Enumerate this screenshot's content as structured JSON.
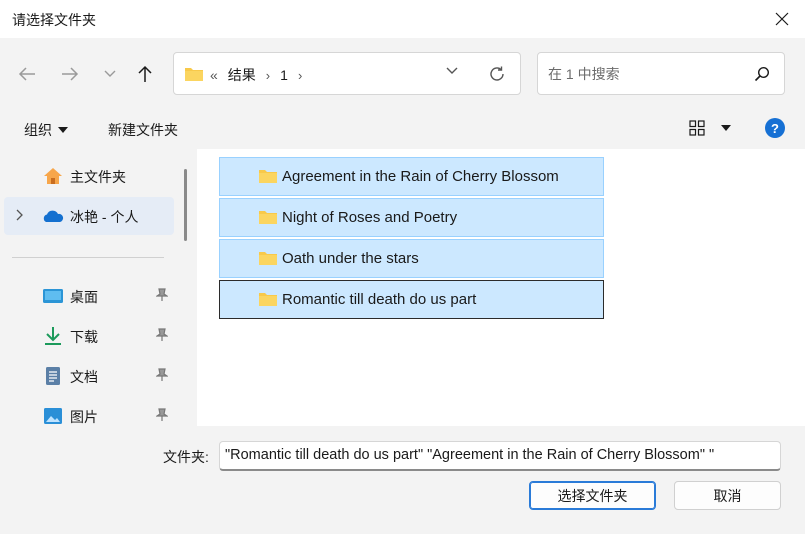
{
  "window": {
    "title": "请选择文件夹"
  },
  "breadcrumb": {
    "overflow": "«",
    "items": [
      "结果",
      "1"
    ],
    "separator": "›"
  },
  "search": {
    "placeholder": "在 1 中搜索"
  },
  "toolbar": {
    "organize": "组织",
    "new_folder": "新建文件夹",
    "help": "?"
  },
  "sidebar": {
    "items": [
      {
        "label": "主文件夹",
        "icon": "home-icon"
      },
      {
        "label": "冰艳 - 个人",
        "icon": "onedrive-cloud-icon"
      },
      {
        "label": "桌面",
        "icon": "desktop-icon"
      },
      {
        "label": "下载",
        "icon": "download-icon"
      },
      {
        "label": "文档",
        "icon": "documents-icon"
      },
      {
        "label": "图片",
        "icon": "pictures-icon"
      }
    ]
  },
  "files": [
    {
      "name": "Agreement in the Rain of Cherry Blossom",
      "selected": true
    },
    {
      "name": "Night of Roses and Poetry",
      "selected": true
    },
    {
      "name": "Oath under the stars",
      "selected": true
    },
    {
      "name": "Romantic till death do us part",
      "selected": true
    }
  ],
  "footer": {
    "label": "文件夹:",
    "value": "\"Romantic till death do us part\" \"Agreement in the Rain of Cherry Blossom\" \"",
    "select_button": "选择文件夹",
    "cancel_button": "取消"
  },
  "colors": {
    "selection_bg": "#cce8ff",
    "selection_border": "#99d1ff",
    "accent": "#1670d4",
    "folder": "#f8c94a"
  }
}
